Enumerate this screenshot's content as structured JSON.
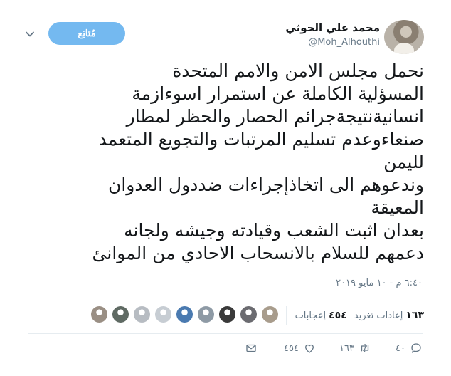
{
  "author": {
    "name": "محمد علي الحوثي",
    "handle": "@Moh_Alhouthi"
  },
  "follow_button": {
    "label": "مُتابَع"
  },
  "tweet": {
    "lines": [
      "نحمل مجلس الامن والامم المتحدة",
      "المسؤلية الكاملة عن استمرار اسوءازمة",
      "انسانيةنتيجةجرائم الحصار والحظر لمطار",
      "صنعاءوعدم تسليم المرتبات والتجويع المتعمد",
      "لليمن",
      "وندعوهم الى اتخاذإجراءات ضددول العدوان",
      "المعيقة",
      "بعدان اثبت الشعب وقيادته وجيشه ولجانه",
      "دعمهم للسلام بالانسحاب الاحادي من الموانئ"
    ],
    "timestamp": "٦:٤٠ م - ١٠ مايو ٢٠١٩"
  },
  "stats": {
    "retweets": {
      "count": "١٦٣",
      "label": "إعادات تغريد"
    },
    "likes": {
      "count": "٤٥٤",
      "label": "إعجابات"
    }
  },
  "likers": [
    {
      "color": "#a89c8c"
    },
    {
      "color": "#6b6b70"
    },
    {
      "color": "#3a3a3a"
    },
    {
      "color": "#8e9aa5"
    },
    {
      "color": "#4a7ab0"
    },
    {
      "color": "#c7cdd3"
    },
    {
      "color": "#b7bcc2"
    },
    {
      "color": "#5f6a63"
    },
    {
      "color": "#9a8f84"
    }
  ],
  "actions": {
    "reply_count": "٤٠",
    "retweet_count": "١٦٣",
    "like_count": "٤٥٤"
  },
  "colors": {
    "accent": "#74b9f0",
    "secondary_text": "#657786",
    "divider": "#e6ecf0"
  }
}
